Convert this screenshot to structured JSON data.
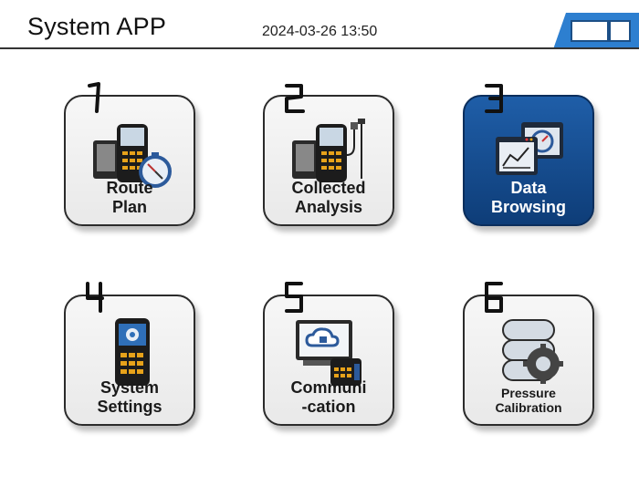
{
  "header": {
    "title": "System APP",
    "datetime": "2024-03-26 13:50"
  },
  "tiles": [
    {
      "number": "1",
      "line1": "Route",
      "line2": "Plan",
      "icon": "route-plan-icon",
      "active": false
    },
    {
      "number": "2",
      "line1": "Collected",
      "line2": "Analysis",
      "icon": "collected-analysis-icon",
      "active": false
    },
    {
      "number": "3",
      "line1": "Data",
      "line2": "Browsing",
      "icon": "data-browsing-icon",
      "active": true
    },
    {
      "number": "4",
      "line1": "System",
      "line2": "Settings",
      "icon": "system-settings-icon",
      "active": false
    },
    {
      "number": "5",
      "line1": "Communi",
      "line2": "-cation",
      "icon": "communication-icon",
      "active": false
    },
    {
      "number": "6",
      "line1": "Pressure",
      "line2": "Calibration",
      "icon": "pressure-calibration-icon",
      "active": false
    }
  ],
  "colors": {
    "active_tile": "#17508f",
    "battery": "#2d7fd0"
  }
}
